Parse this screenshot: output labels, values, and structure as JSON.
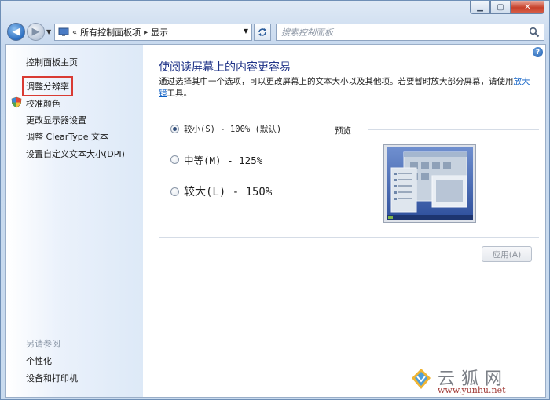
{
  "window": {
    "caption_buttons": [
      "minimize-icon",
      "maximize-icon",
      "close-icon"
    ]
  },
  "address": {
    "overflow": "«",
    "crumbs": [
      "所有控制面板项",
      "显示"
    ],
    "search_placeholder": "搜索控制面板"
  },
  "sidebar": {
    "items": [
      {
        "label": "控制面板主页"
      },
      {
        "label": "调整分辨率",
        "highlighted": true
      },
      {
        "label": "校准颜色",
        "icon": "shield-icon"
      },
      {
        "label": "更改显示器设置"
      },
      {
        "label": "调整 ClearType 文本"
      },
      {
        "label": "设置自定义文本大小(DPI)"
      }
    ],
    "see_also_title": "另请参阅",
    "see_also": [
      {
        "label": "个性化"
      },
      {
        "label": "设备和打印机"
      }
    ]
  },
  "main": {
    "title": "使阅读屏幕上的内容更容易",
    "description": "通过选择其中一个选项，可以更改屏幕上的文本大小以及其他项。若要暂时放大部分屏幕，请使用",
    "description_link": "放大镜",
    "description_tail": "工具。",
    "options": [
      {
        "label": "较小(S) - 100% (默认)",
        "selected": true
      },
      {
        "label": "中等(M) - 125%",
        "selected": false
      },
      {
        "label": "较大(L) - 150%",
        "selected": false
      }
    ],
    "preview_label": "预览",
    "apply_label": "应用(A)",
    "apply_enabled": false
  },
  "watermark": {
    "title": "云狐网",
    "url": "www.yunhu.net"
  },
  "colors": {
    "title": "#1e3287",
    "link": "#0b5ec4",
    "highlight_box": "#d93b33",
    "watermark_url": "#a23c38"
  }
}
